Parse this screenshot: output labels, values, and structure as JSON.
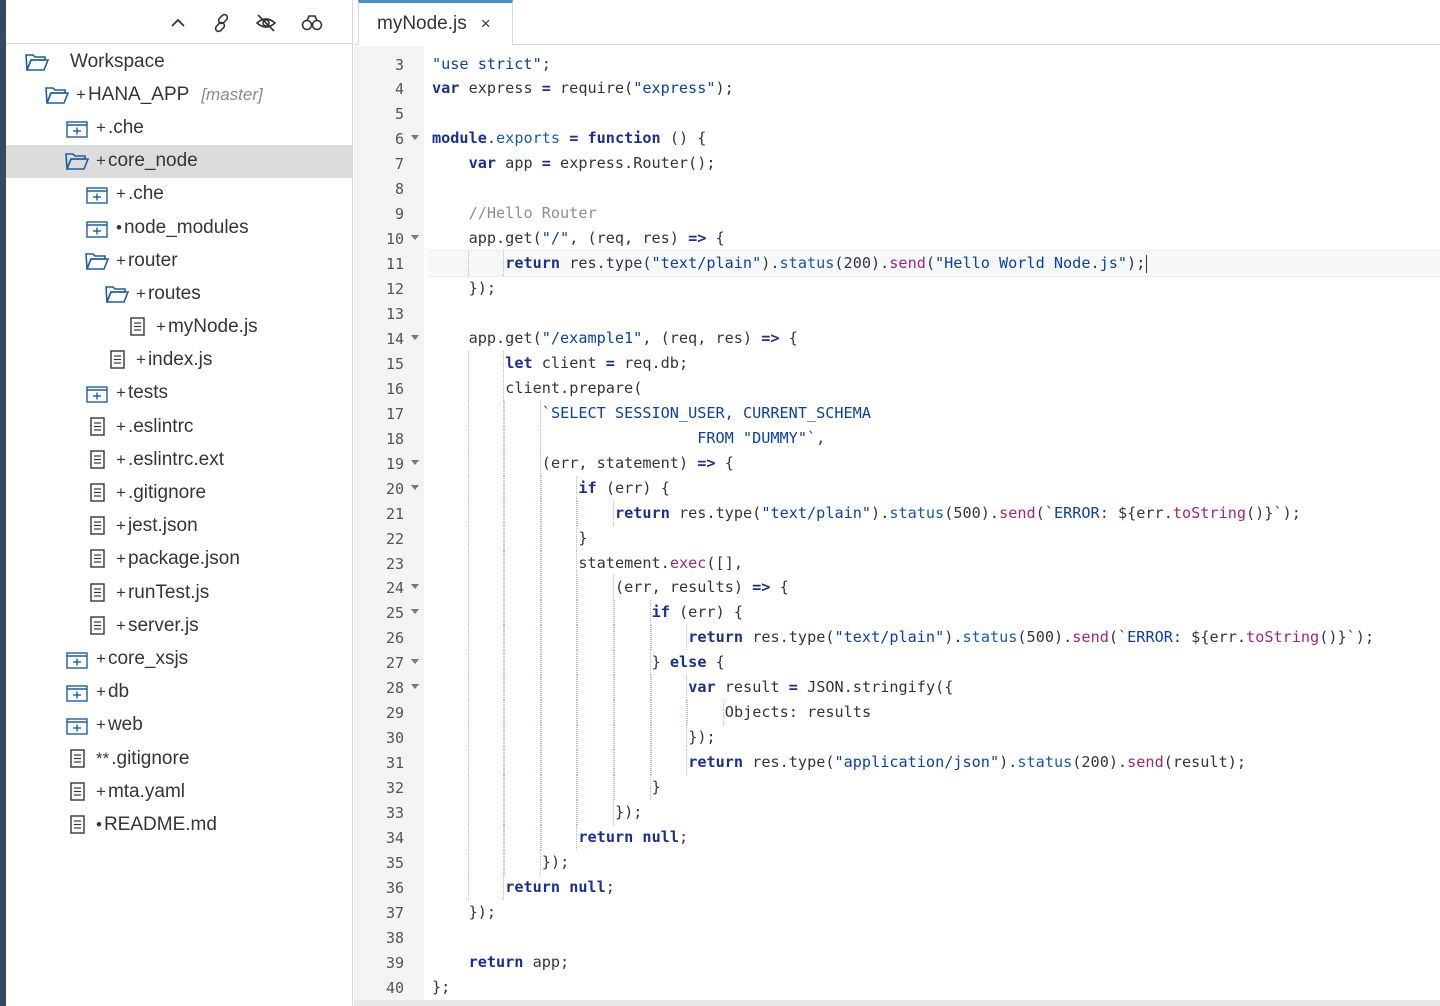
{
  "explorer": {
    "toolbar": [
      "collapse-all",
      "link-with-editor",
      "hide-hidden-files",
      "binoculars-search"
    ],
    "tree": [
      {
        "label": "Workspace",
        "prefix": "",
        "icon": "folder-open-icon",
        "level": 0,
        "branch": ""
      },
      {
        "label": "HANA_APP",
        "prefix": "+",
        "icon": "folder-open-icon",
        "level": 1,
        "branch": "[master]"
      },
      {
        "label": ".che",
        "prefix": "+",
        "icon": "folder-closed-icon",
        "level": 2,
        "branch": ""
      },
      {
        "label": "core_node",
        "prefix": "+",
        "icon": "folder-open-icon",
        "level": 2,
        "branch": "",
        "selected": true
      },
      {
        "label": ".che",
        "prefix": "+",
        "icon": "folder-closed-icon",
        "level": 3,
        "branch": ""
      },
      {
        "label": "node_modules",
        "prefix": "•",
        "icon": "folder-closed-icon",
        "level": 3,
        "branch": ""
      },
      {
        "label": "router",
        "prefix": "+",
        "icon": "folder-open-icon",
        "level": 3,
        "branch": ""
      },
      {
        "label": "routes",
        "prefix": "+",
        "icon": "folder-open-icon",
        "level": 4,
        "branch": ""
      },
      {
        "label": "myNode.js",
        "prefix": "+",
        "icon": "file-icon",
        "level": 5,
        "branch": ""
      },
      {
        "label": "index.js",
        "prefix": "+",
        "icon": "file-icon",
        "level": 4,
        "branch": ""
      },
      {
        "label": "tests",
        "prefix": "+",
        "icon": "folder-closed-icon",
        "level": 3,
        "branch": ""
      },
      {
        "label": ".eslintrc",
        "prefix": "+",
        "icon": "file-icon",
        "level": 3,
        "branch": ""
      },
      {
        "label": ".eslintrc.ext",
        "prefix": "+",
        "icon": "file-icon",
        "level": 3,
        "branch": ""
      },
      {
        "label": ".gitignore",
        "prefix": "+",
        "icon": "file-icon",
        "level": 3,
        "branch": ""
      },
      {
        "label": "jest.json",
        "prefix": "+",
        "icon": "file-icon",
        "level": 3,
        "branch": ""
      },
      {
        "label": "package.json",
        "prefix": "+",
        "icon": "file-icon",
        "level": 3,
        "branch": ""
      },
      {
        "label": "runTest.js",
        "prefix": "+",
        "icon": "file-icon",
        "level": 3,
        "branch": ""
      },
      {
        "label": "server.js",
        "prefix": "+",
        "icon": "file-icon",
        "level": 3,
        "branch": ""
      },
      {
        "label": "core_xsjs",
        "prefix": "+",
        "icon": "folder-closed-icon",
        "level": 2,
        "branch": ""
      },
      {
        "label": "db",
        "prefix": "+",
        "icon": "folder-closed-icon",
        "level": 2,
        "branch": ""
      },
      {
        "label": "web",
        "prefix": "+",
        "icon": "folder-closed-icon",
        "level": 2,
        "branch": ""
      },
      {
        "label": ".gitignore",
        "prefix": "**",
        "icon": "file-icon",
        "level": 2,
        "branch": ""
      },
      {
        "label": "mta.yaml",
        "prefix": "+",
        "icon": "file-icon",
        "level": 2,
        "branch": ""
      },
      {
        "label": "README.md",
        "prefix": "•",
        "icon": "file-icon",
        "level": 2,
        "branch": ""
      }
    ]
  },
  "editor": {
    "tab": {
      "label": "myNode.js",
      "close": "×"
    },
    "first_line": 3,
    "fold_lines": [
      6,
      10,
      14,
      19,
      20,
      24,
      25,
      27,
      28
    ],
    "active_line": 11,
    "lines": [
      {
        "indent": 0,
        "tokens": [
          [
            "str",
            "\"use strict\""
          ],
          [
            "",
            ";"
          ]
        ]
      },
      {
        "indent": 0,
        "tokens": [
          [
            "kw",
            "var"
          ],
          [
            "",
            " express "
          ],
          [
            "kw",
            "="
          ],
          [
            "",
            " require("
          ],
          [
            "str",
            "\"express\""
          ],
          [
            "",
            ");"
          ]
        ]
      },
      {
        "indent": 0,
        "tokens": []
      },
      {
        "indent": 0,
        "tokens": [
          [
            "kw",
            "module"
          ],
          [
            "",
            "."
          ],
          [
            "prop",
            "exports"
          ],
          [
            "",
            " "
          ],
          [
            "kw",
            "="
          ],
          [
            "",
            " "
          ],
          [
            "kw",
            "function"
          ],
          [
            "",
            " () {"
          ]
        ]
      },
      {
        "indent": 1,
        "tokens": [
          [
            "kw",
            "var"
          ],
          [
            "",
            " app "
          ],
          [
            "kw",
            "="
          ],
          [
            "",
            " express.Router();"
          ]
        ]
      },
      {
        "indent": 1,
        "tokens": []
      },
      {
        "indent": 1,
        "tokens": [
          [
            "cm",
            "//Hello Router"
          ]
        ]
      },
      {
        "indent": 1,
        "tokens": [
          [
            "",
            "app.get("
          ],
          [
            "str",
            "\"/\""
          ],
          [
            "",
            ", (req, res) "
          ],
          [
            "kw",
            "=>"
          ],
          [
            "",
            " {"
          ]
        ]
      },
      {
        "indent": 2,
        "tokens": [
          [
            "kw",
            "return"
          ],
          [
            "",
            " res.type("
          ],
          [
            "str",
            "\"text/plain\""
          ],
          [
            "",
            ")."
          ],
          [
            "prop",
            "status"
          ],
          [
            "",
            "(200)."
          ],
          [
            "fn",
            "send"
          ],
          [
            "",
            "("
          ],
          [
            "str",
            "\"Hello World Node.js\""
          ],
          [
            "",
            ");"
          ]
        ]
      },
      {
        "indent": 1,
        "tokens": [
          [
            "",
            "});"
          ]
        ]
      },
      {
        "indent": 1,
        "tokens": []
      },
      {
        "indent": 1,
        "tokens": [
          [
            "",
            "app.get("
          ],
          [
            "str",
            "\"/example1\""
          ],
          [
            "",
            ", (req, res) "
          ],
          [
            "kw",
            "=>"
          ],
          [
            "",
            " {"
          ]
        ]
      },
      {
        "indent": 2,
        "tokens": [
          [
            "kw",
            "let"
          ],
          [
            "",
            " client "
          ],
          [
            "kw",
            "="
          ],
          [
            "",
            " req.db;"
          ]
        ]
      },
      {
        "indent": 2,
        "tokens": [
          [
            "",
            "client.prepare("
          ]
        ]
      },
      {
        "indent": 3,
        "tokens": [
          [
            "str",
            "`SELECT SESSION_USER, CURRENT_SCHEMA"
          ]
        ]
      },
      {
        "indent": 3,
        "tokens": [
          [
            "str",
            "                 FROM \"DUMMY\"`"
          ],
          [
            "",
            ","
          ]
        ]
      },
      {
        "indent": 3,
        "tokens": [
          [
            "",
            "(err, statement) "
          ],
          [
            "kw",
            "=>"
          ],
          [
            "",
            " {"
          ]
        ]
      },
      {
        "indent": 4,
        "tokens": [
          [
            "kw",
            "if"
          ],
          [
            "",
            " (err) {"
          ]
        ]
      },
      {
        "indent": 5,
        "tokens": [
          [
            "kw",
            "return"
          ],
          [
            "",
            " res.type("
          ],
          [
            "str",
            "\"text/plain\""
          ],
          [
            "",
            ")."
          ],
          [
            "prop",
            "status"
          ],
          [
            "",
            "(500)."
          ],
          [
            "fn",
            "send"
          ],
          [
            "",
            "("
          ],
          [
            "str",
            "`ERROR: "
          ],
          [
            "",
            "${err."
          ],
          [
            "fn",
            "toString"
          ],
          [
            "",
            "()}"
          ],
          [
            "str",
            "`"
          ],
          [
            "",
            ");"
          ]
        ]
      },
      {
        "indent": 4,
        "tokens": [
          [
            "",
            "}"
          ]
        ]
      },
      {
        "indent": 4,
        "tokens": [
          [
            "",
            "statement."
          ],
          [
            "fn",
            "exec"
          ],
          [
            "",
            "([],"
          ]
        ]
      },
      {
        "indent": 5,
        "tokens": [
          [
            "",
            "(err, results) "
          ],
          [
            "kw",
            "=>"
          ],
          [
            "",
            " {"
          ]
        ]
      },
      {
        "indent": 6,
        "tokens": [
          [
            "kw",
            "if"
          ],
          [
            "",
            " (err) {"
          ]
        ]
      },
      {
        "indent": 7,
        "tokens": [
          [
            "kw",
            "return"
          ],
          [
            "",
            " res.type("
          ],
          [
            "str",
            "\"text/plain\""
          ],
          [
            "",
            ")."
          ],
          [
            "prop",
            "status"
          ],
          [
            "",
            "(500)."
          ],
          [
            "fn",
            "send"
          ],
          [
            "",
            "("
          ],
          [
            "str",
            "`ERROR: "
          ],
          [
            "",
            "${err."
          ],
          [
            "fn",
            "toString"
          ],
          [
            "",
            "()}"
          ],
          [
            "str",
            "`"
          ],
          [
            "",
            ");"
          ]
        ]
      },
      {
        "indent": 6,
        "tokens": [
          [
            "",
            "} "
          ],
          [
            "kw",
            "else"
          ],
          [
            "",
            " {"
          ]
        ]
      },
      {
        "indent": 7,
        "tokens": [
          [
            "kw",
            "var"
          ],
          [
            "",
            " result "
          ],
          [
            "kw",
            "="
          ],
          [
            "",
            " JSON.stringify({"
          ]
        ]
      },
      {
        "indent": 8,
        "tokens": [
          [
            "",
            "Objects: results"
          ]
        ]
      },
      {
        "indent": 7,
        "tokens": [
          [
            "",
            "});"
          ]
        ]
      },
      {
        "indent": 7,
        "tokens": [
          [
            "kw",
            "return"
          ],
          [
            "",
            " res.type("
          ],
          [
            "str",
            "\"application/json\""
          ],
          [
            "",
            ")."
          ],
          [
            "prop",
            "status"
          ],
          [
            "",
            "(200)."
          ],
          [
            "fn",
            "send"
          ],
          [
            "",
            "(result);"
          ]
        ]
      },
      {
        "indent": 6,
        "tokens": [
          [
            "",
            "}"
          ]
        ]
      },
      {
        "indent": 5,
        "tokens": [
          [
            "",
            "});"
          ]
        ]
      },
      {
        "indent": 4,
        "tokens": [
          [
            "kw",
            "return"
          ],
          [
            "",
            " "
          ],
          [
            "kw",
            "null"
          ],
          [
            "",
            ";"
          ]
        ]
      },
      {
        "indent": 3,
        "tokens": [
          [
            "",
            "});"
          ]
        ]
      },
      {
        "indent": 2,
        "tokens": [
          [
            "kw",
            "return"
          ],
          [
            "",
            " "
          ],
          [
            "kw",
            "null"
          ],
          [
            "",
            ";"
          ]
        ]
      },
      {
        "indent": 1,
        "tokens": [
          [
            "",
            "});"
          ]
        ]
      },
      {
        "indent": 1,
        "tokens": []
      },
      {
        "indent": 1,
        "tokens": [
          [
            "kw",
            "return"
          ],
          [
            "",
            " app;"
          ]
        ]
      },
      {
        "indent": 0,
        "tokens": [
          [
            "",
            "};"
          ]
        ]
      }
    ]
  },
  "colors": {
    "keyword": "#1c2f8f",
    "string": "#0b3fa8",
    "comment": "#8a8e92",
    "method": "#a1267a",
    "selection": "#dcdcdc"
  }
}
